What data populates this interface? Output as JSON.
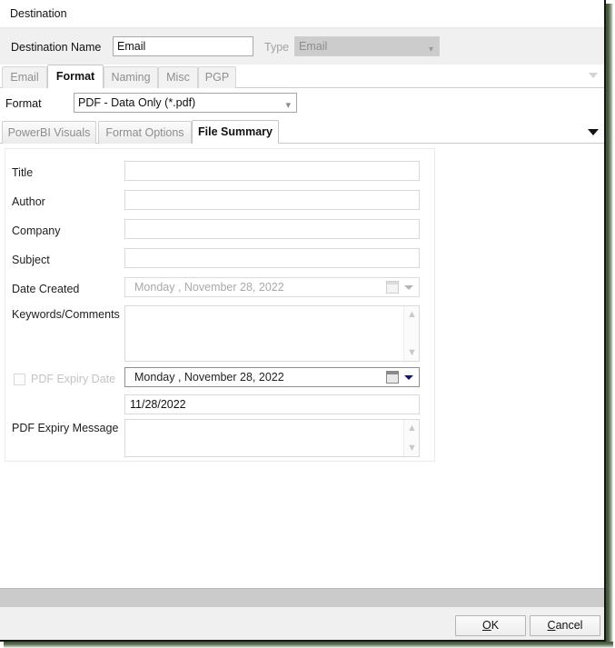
{
  "window": {
    "title": "Destination"
  },
  "destination": {
    "name_label": "Destination Name",
    "name_value": "Email",
    "type_label": "Type",
    "type_value": "Email",
    "type_caret_icon": "chevron-down-icon"
  },
  "tabs_primary": {
    "items": [
      {
        "label": "Email",
        "active": false
      },
      {
        "label": "Format",
        "active": true
      },
      {
        "label": "Naming",
        "active": false
      },
      {
        "label": "Misc",
        "active": false
      },
      {
        "label": "PGP",
        "active": false
      }
    ],
    "overflow_icon": "chevron-down-icon"
  },
  "format": {
    "label": "Format",
    "value": "PDF - Data Only (*.pdf)",
    "caret_icon": "chevron-down-icon"
  },
  "tabs_secondary": {
    "items": [
      {
        "label": "PowerBI Visuals",
        "active": false
      },
      {
        "label": "Format Options",
        "active": false
      },
      {
        "label": "File Summary",
        "active": true
      }
    ],
    "overflow_icon": "chevron-down-icon"
  },
  "file_summary": {
    "title": {
      "label": "Title",
      "value": ""
    },
    "author": {
      "label": "Author",
      "value": ""
    },
    "company": {
      "label": "Company",
      "value": ""
    },
    "subject": {
      "label": "Subject",
      "value": ""
    },
    "date_created": {
      "label": "Date Created",
      "value": "Monday    , November  28, 2022",
      "calendar_icon": "calendar-icon",
      "caret_icon": "chevron-down-icon"
    },
    "keywords": {
      "label": "Keywords/Comments",
      "value": ""
    },
    "pdf_expiry_date": {
      "label": "PDF Expiry Date",
      "checked": false,
      "value": "Monday    , November  28, 2022",
      "calendar_icon": "calendar-icon",
      "caret_icon": "chevron-down-icon"
    },
    "pdf_expiry_short": {
      "value": "11/28/2022"
    },
    "pdf_expiry_message": {
      "label": "PDF Expiry Message",
      "value": ""
    },
    "scroll_up_icon": "chevron-up-icon",
    "scroll_down_icon": "chevron-down-icon"
  },
  "footer": {
    "ok": {
      "accel": "O",
      "rest": "K"
    },
    "cancel": {
      "accel": "C",
      "rest": "ancel"
    }
  },
  "colors": {
    "header_bg": "#f0f0f0",
    "panel_border": "#ebebeb",
    "grey_band": "#cbcbcb",
    "disabled_text": "#a9a9a9",
    "window_shadow": "#4c6044"
  }
}
